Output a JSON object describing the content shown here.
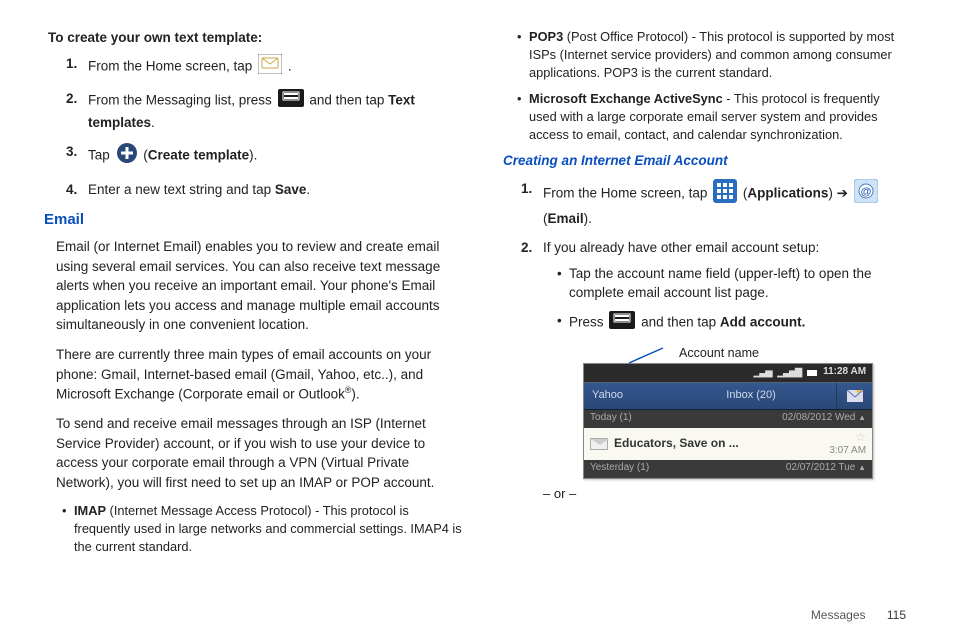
{
  "left": {
    "title": "To create your own text template:",
    "steps": {
      "s1a": "From the Home screen, tap ",
      "s1b": ".",
      "s2a": "From the Messaging list, press ",
      "s2b": " and then tap ",
      "s2c": "Text templates",
      "s2d": ".",
      "s3a": "Tap ",
      "s3b": " (",
      "s3c": "Create template",
      "s3d": ").",
      "s4a": "Enter a new text string and tap ",
      "s4b": "Save",
      "s4c": "."
    },
    "emailHeading": "Email",
    "p1": "Email (or Internet Email) enables you to review and create email using several email services. You can also receive text message alerts when you receive an important email. Your phone's Email application lets you access and manage multiple email accounts simultaneously in one convenient location.",
    "p2a": "There are currently three main types of email accounts on your phone: Gmail, Internet-based email (Gmail, Yahoo, etc..), and Microsoft Exchange (Corporate email or Outlook",
    "p2b": "®",
    "p2c": ").",
    "p3": "To send and receive email messages through an ISP (Internet Service Provider) account, or if you wish to use your device to access your corporate email through a VPN (Virtual Private Network), you will first need to set up an IMAP or POP account.",
    "imapB": "IMAP",
    "imapT": " (Internet Message Access Protocol) - This protocol is frequently used in large networks and commercial settings. IMAP4 is the current standard."
  },
  "right": {
    "pop3B": "POP3",
    "pop3T": " (Post Office Protocol) - This protocol is supported by most ISPs (Internet service providers) and common among consumer applications. POP3 is the current standard.",
    "measB": "Microsoft Exchange ActiveSync",
    "measT": " - This protocol is frequently used with a large corporate email server system and provides access to email, contact, and calendar synchronization.",
    "subHeading": "Creating an Internet Email Account",
    "s1a": "From the Home screen, tap ",
    "s1b": " (",
    "s1c": "Applications",
    "s1d": ") ➔ ",
    "s1e": " (",
    "s1f": "Email",
    "s1g": ").",
    "s2": "If you already have other email account setup:",
    "sub1": "Tap the account name field (upper-left) to open the complete email account list page.",
    "sub2a": "Press ",
    "sub2b": " and then tap ",
    "sub2c": "Add account.",
    "label": "Account name",
    "or": "– or –"
  },
  "screenshot": {
    "time": "11:28 AM",
    "acc": "Yahoo",
    "inbox": "Inbox (20)",
    "today": "Today (1)",
    "todayDate": "02/08/2012 Wed",
    "subj": "Educators, Save on ...",
    "msgTime": "3:07 AM",
    "yest": "Yesterday (1)",
    "yestDate": "02/07/2012 Tue"
  },
  "footer": {
    "section": "Messages",
    "page": "115"
  }
}
